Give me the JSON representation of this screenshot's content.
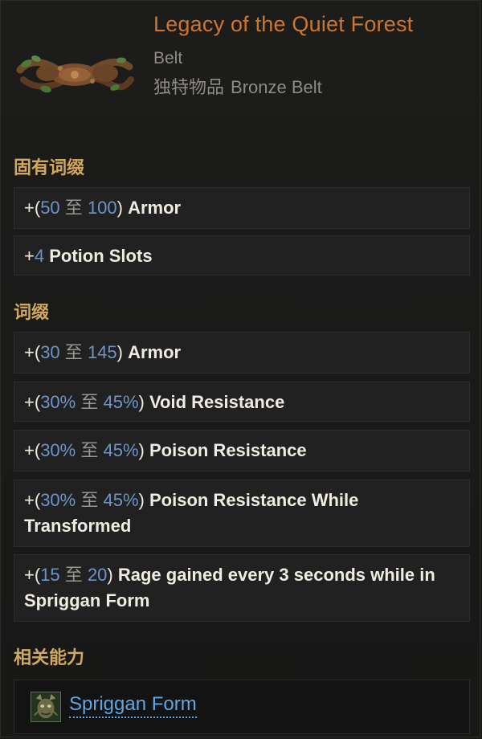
{
  "item": {
    "name": "Legacy of the Quiet Forest",
    "type": "Belt",
    "rarity_label": "独特物品",
    "base_type": "Bronze Belt",
    "icon": "bronze-belt-icon"
  },
  "implicit_section": {
    "label": "固有词缀",
    "rows": [
      {
        "prefix": "+(",
        "min": "50",
        "sep": "至",
        "max": "100",
        "suffix": ")",
        "text": " Armor"
      },
      {
        "prefix": "+",
        "value": "4",
        "text": " Potion Slots"
      }
    ]
  },
  "affix_section": {
    "label": "词缀",
    "rows": [
      {
        "prefix": "+(",
        "min": "30",
        "sep": "至",
        "max": "145",
        "suffix": ")",
        "text": " Armor"
      },
      {
        "prefix": "+(",
        "min": "30%",
        "sep": "至",
        "max": "45%",
        "suffix": ")",
        "text": " Void Resistance"
      },
      {
        "prefix": "+(",
        "min": "30%",
        "sep": "至",
        "max": "45%",
        "suffix": ")",
        "text": " Poison Resistance"
      },
      {
        "prefix": "+(",
        "min": "30%",
        "sep": "至",
        "max": "45%",
        "suffix": ")",
        "text": " Poison Resistance While Transformed"
      },
      {
        "prefix": "+(",
        "min": "15",
        "sep": "至",
        "max": "20",
        "suffix": ")",
        "text": " Rage gained every 3 seconds while in Spriggan Form"
      }
    ]
  },
  "ability_section": {
    "label": "相关能力",
    "ability_name": "Spriggan Form",
    "icon": "spriggan-face-icon"
  },
  "colors": {
    "title": "#d0762a",
    "section_label": "#d1a85c",
    "value": "#6c95cc",
    "link": "#5ea7e4"
  }
}
